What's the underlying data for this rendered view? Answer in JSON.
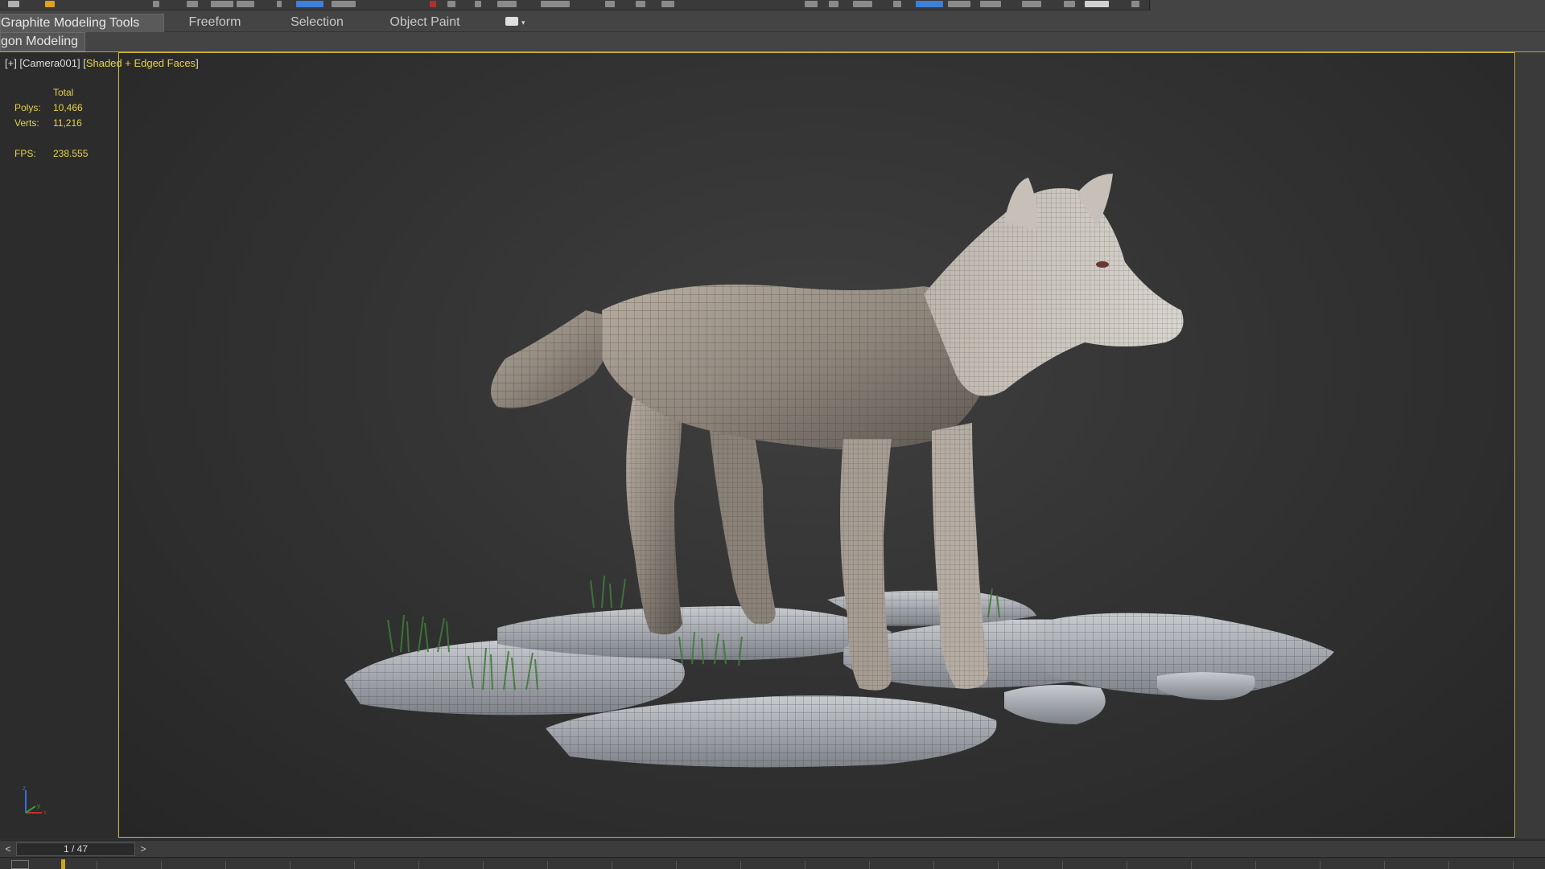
{
  "toolbar": {
    "icons": [
      "undo-icon",
      "redo-icon",
      "select-link-icon",
      "unlink-icon",
      "bind-space-warp-icon",
      "selection-filter-dropdown",
      "select-object-icon",
      "select-by-name-icon",
      "rectangular-selection-icon",
      "window-crossing-icon",
      "select-move-icon",
      "select-rotate-icon",
      "select-scale-icon",
      "reference-coordinate-dropdown",
      "pivot-icon",
      "select-manipulate-icon",
      "keyboard-shortcut-override-icon",
      "snaps-toggle-icon",
      "angle-snap-icon",
      "percent-snap-icon",
      "spinner-snap-icon",
      "named-selection-sets-dropdown",
      "mirror-icon",
      "align-icon",
      "layer-manager-icon",
      "ribbon-toggle-icon",
      "curve-editor-icon",
      "schematic-view-icon",
      "material-editor-icon",
      "render-setup-icon",
      "rendered-frame-window-icon",
      "render-production-icon"
    ]
  },
  "ribbon": {
    "tabs": [
      "Graphite Modeling Tools",
      "Freeform",
      "Selection",
      "Object Paint"
    ],
    "active_tab": "Graphite Modeling Tools"
  },
  "subpanel": {
    "label": "gon Modeling"
  },
  "viewport": {
    "label_prefix": "[+] [Camera001] [",
    "shading_mode": "Shaded + Edged Faces",
    "label_suffix": "]",
    "stats": {
      "header": "Total",
      "polys_label": "Polys:",
      "polys_value": "10,466",
      "verts_label": "Verts:",
      "verts_value": "11,216",
      "fps_label": "FPS:",
      "fps_value": "238.555"
    },
    "axis": {
      "z": "z",
      "x": "x",
      "y": "y"
    }
  },
  "timeslider": {
    "prev": "<",
    "frame": "1 / 47",
    "next": ">"
  },
  "colors": {
    "accent_yellow": "#e6d24a",
    "viewport_border": "#c9b43a",
    "active_blue": "#3d7fd9"
  }
}
